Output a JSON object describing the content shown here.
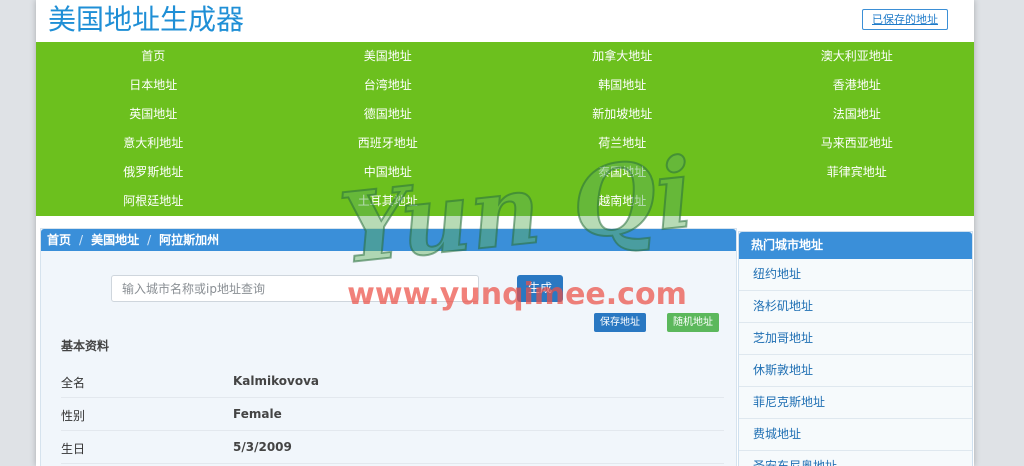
{
  "header": {
    "site_title": "美国地址生成器",
    "saved_addresses_link": "已保存的地址"
  },
  "nav": {
    "items": [
      {
        "label": "首页"
      },
      {
        "label": "美国地址"
      },
      {
        "label": "加拿大地址"
      },
      {
        "label": "澳大利亚地址"
      },
      {
        "label": "日本地址"
      },
      {
        "label": "台湾地址"
      },
      {
        "label": "韩国地址"
      },
      {
        "label": "香港地址"
      },
      {
        "label": "英国地址"
      },
      {
        "label": "德国地址"
      },
      {
        "label": "新加坡地址"
      },
      {
        "label": "法国地址"
      },
      {
        "label": "意大利地址"
      },
      {
        "label": "西班牙地址"
      },
      {
        "label": "荷兰地址"
      },
      {
        "label": "马来西亚地址"
      },
      {
        "label": "俄罗斯地址"
      },
      {
        "label": "中国地址"
      },
      {
        "label": "泰国地址"
      },
      {
        "label": "菲律宾地址"
      },
      {
        "label": "阿根廷地址"
      },
      {
        "label": "土耳其地址"
      },
      {
        "label": "越南地址"
      }
    ]
  },
  "breadcrumb": {
    "home": "首页",
    "sep": "/",
    "country": "美国地址",
    "state": "阿拉斯加州"
  },
  "search": {
    "placeholder": "输入城市名称或ip地址查询",
    "generate_label": "生成"
  },
  "actions": {
    "save_label": "保存地址",
    "random_label": "随机地址"
  },
  "profile": {
    "section_title": "基本资料",
    "rows": [
      {
        "label": "全名",
        "value": "Kalmikovova"
      },
      {
        "label": "性别",
        "value": "Female"
      },
      {
        "label": "生日",
        "value": "5/3/2009"
      }
    ]
  },
  "sidebar": {
    "title": "热门城市地址",
    "items": [
      {
        "label": "纽约地址"
      },
      {
        "label": "洛杉矶地址"
      },
      {
        "label": "芝加哥地址"
      },
      {
        "label": "休斯敦地址"
      },
      {
        "label": "菲尼克斯地址"
      },
      {
        "label": "费城地址"
      },
      {
        "label": "圣安东尼奥地址"
      }
    ]
  },
  "watermark": {
    "script_text": "Yun Qi",
    "url_text": "www.yunqimee.com"
  },
  "colors": {
    "brand_blue": "#1f8fd6",
    "nav_green": "#6cc01e",
    "header_blue": "#3a8fd9",
    "button_blue": "#2a78c2",
    "button_green": "#5cb85c"
  }
}
